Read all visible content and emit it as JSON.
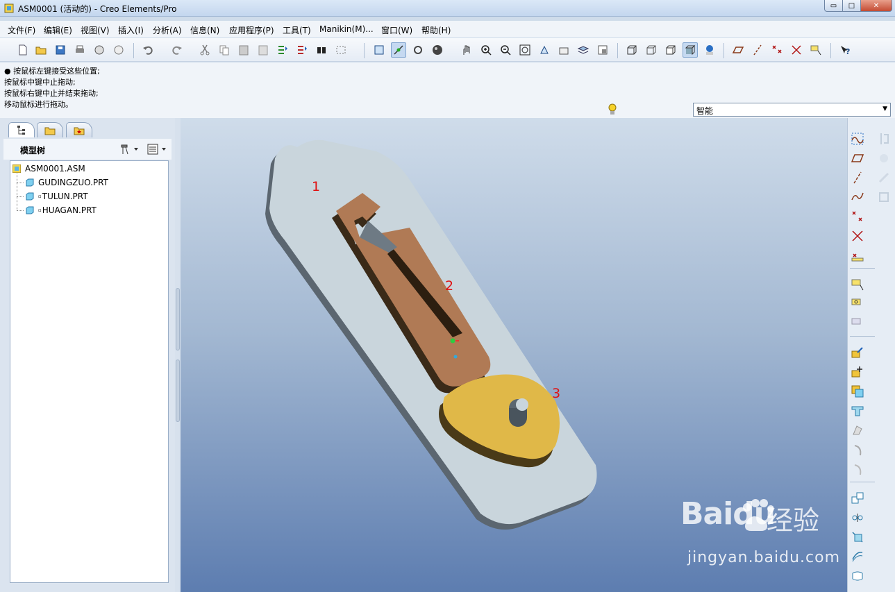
{
  "window": {
    "title": "ASM0001 (活动的) - Creo Elements/Pro",
    "min_glyph": "▭",
    "max_glyph": "□",
    "close_glyph": "✕"
  },
  "menu": [
    "文件(F)",
    "编辑(E)",
    "视图(V)",
    "插入(I)",
    "分析(A)",
    "信息(N)",
    "应用程序(P)",
    "工具(T)",
    "Manikin(M)...",
    "窗口(W)",
    "帮助(H)"
  ],
  "messages": [
    "● 按鼠标左键接受这些位置;",
    "按鼠标中键中止拖动;",
    "按鼠标右键中止并结束拖动;",
    "移动鼠标进行拖动。"
  ],
  "filter": {
    "selected": "智能",
    "arrow": "▼"
  },
  "model_tree": {
    "title": "模型树",
    "items": [
      {
        "label": "ASM0001.ASM",
        "type": "assembly"
      },
      {
        "label": "GUDINGZUO.PRT",
        "type": "part"
      },
      {
        "label": "TULUN.PRT",
        "type": "part"
      },
      {
        "label": "HUAGAN.PRT",
        "type": "part"
      }
    ]
  },
  "viewport_labels": [
    "1",
    "2",
    "3"
  ],
  "watermark": {
    "brand": "Baidu",
    "suffix": "经验",
    "url": "jingyan.baidu.com"
  },
  "colors": {
    "base_plate": "#c9d5dc",
    "slider": "#b07a55",
    "cam": "#e0b848",
    "label": "#e01010"
  }
}
